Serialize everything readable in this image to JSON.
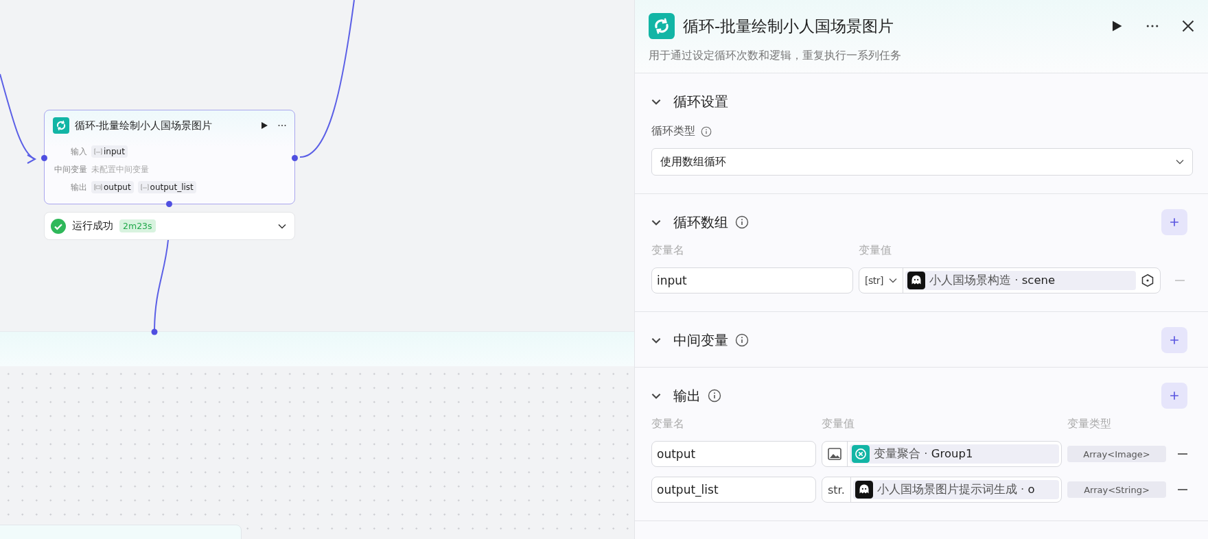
{
  "canvas": {
    "node": {
      "title": "循环-批量绘制小人国场景图片",
      "rows": [
        {
          "label": "输入",
          "tags": [
            {
              "kind": "str",
              "name": "input"
            }
          ]
        },
        {
          "label": "中间变量",
          "empty_text": "未配置中间变量"
        },
        {
          "label": "输出",
          "tags": [
            {
              "kind": "list",
              "name": "output"
            },
            {
              "kind": "str",
              "name": "output_list"
            }
          ]
        }
      ]
    },
    "run_status": {
      "success": true,
      "text": "运行成功",
      "duration": "2m23s",
      "expanded": false
    }
  },
  "panel": {
    "title": "循环-批量绘制小人国场景图片",
    "description": "用于通过设定循环次数和逻辑，重复执行一系列任务",
    "sections": [
      {
        "kind": "settings",
        "title": "循环设置",
        "expanded": true,
        "field_label": "循环类型",
        "select_value": "使用数组循环"
      },
      {
        "kind": "variables",
        "title": "循环数组",
        "expanded": true,
        "info": true,
        "add": true,
        "columns": [
          "变量名",
          "变量值"
        ],
        "rows": [
          {
            "name": "input",
            "type": {
              "kind": "select",
              "label": "[str]"
            },
            "source": {
              "kind": "ghost"
            },
            "ref": "小人国场景构造 ·",
            "field": "scene"
          }
        ]
      },
      {
        "kind": "variables",
        "title": "中间变量",
        "expanded": true,
        "info": true,
        "add": true
      },
      {
        "kind": "variables",
        "title": "输出",
        "expanded": true,
        "info": true,
        "add": true,
        "columns": [
          "变量名",
          "变量值",
          "变量类型"
        ],
        "rows": [
          {
            "name": "output",
            "type": {
              "kind": "image"
            },
            "source": {
              "kind": "aggregate"
            },
            "ref": "变量聚合 ·",
            "field": "Group1",
            "var_type": "Array<Image>"
          },
          {
            "name": "output_list",
            "type": {
              "kind": "text",
              "label": "str."
            },
            "source": {
              "kind": "ghost"
            },
            "ref": "小人国场景图片提示词生成 ·",
            "field": "o",
            "var_type": "Array<String>"
          }
        ]
      }
    ]
  }
}
